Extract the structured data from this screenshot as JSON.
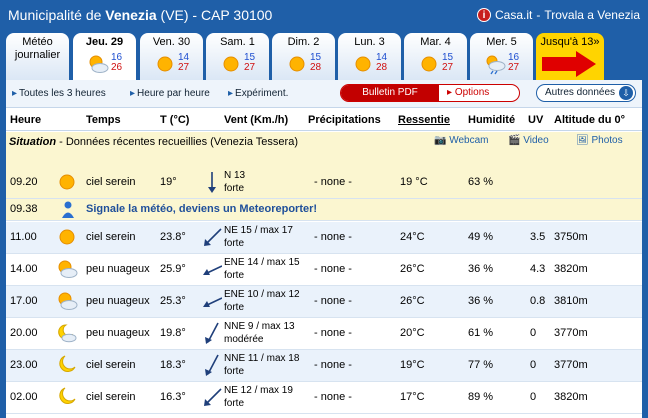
{
  "topbar": {
    "title_prefix": "Municipalité de",
    "city": "Venezia",
    "title_suffix": "(VE) - CAP 30100",
    "link_casa": "Casa.it",
    "link_sep": " - ",
    "link_trovala": "Trovala a Venezia"
  },
  "tabs": [
    {
      "day": "Météo journalier",
      "tmin": "",
      "tmax": ""
    },
    {
      "day": "Jeu. 29",
      "tmin": "16",
      "tmax": "26"
    },
    {
      "day": "Ven. 30",
      "tmin": "14",
      "tmax": "27"
    },
    {
      "day": "Sam. 1",
      "tmin": "15",
      "tmax": "27"
    },
    {
      "day": "Dim. 2",
      "tmin": "15",
      "tmax": "28"
    },
    {
      "day": "Lun. 3",
      "tmin": "14",
      "tmax": "28"
    },
    {
      "day": "Mar. 4",
      "tmin": "15",
      "tmax": "27"
    },
    {
      "day": "Mer. 5",
      "tmin": "16",
      "tmax": "27"
    },
    {
      "day": "Jusqu'à 13»",
      "tmin": "",
      "tmax": ""
    }
  ],
  "options": {
    "toutes": "Toutes les 3 heures",
    "heure": "Heure par heure",
    "experiment": "Expériment.",
    "pdf": "Bulletin PDF",
    "options": "Options",
    "autres": "Autres données"
  },
  "header": {
    "heure": "Heure",
    "temps": "Temps",
    "temp": "T (°C)",
    "vent": "Vent (Km./h)",
    "precip": "Précipitations",
    "ressentie": "Ressentie",
    "humidite": "Humidité",
    "uv": "UV",
    "altitude": "Altitude du 0°"
  },
  "situation": {
    "label": "Situation",
    "text": "- Données récentes recueillies (Venezia Tessera)",
    "webcam": "Webcam",
    "video": "Video",
    "photos": "Photos"
  },
  "meteo_msg": "Signale la météo, deviens un Meteoreporter!",
  "rows": [
    {
      "time": "09.20",
      "icon": "sun",
      "sky": "ciel serein",
      "temp": "19°",
      "wind": "N 13",
      "strength": "forte",
      "precip": "- none -",
      "feel": "19 °C",
      "hum": "63 %",
      "uv": "",
      "alt": ""
    },
    {
      "time": "09.38",
      "icon": "reporter",
      "sky": "",
      "temp": "",
      "wind": "",
      "strength": "",
      "precip": "",
      "feel": "",
      "hum": "",
      "uv": "",
      "alt": ""
    },
    {
      "time": "11.00",
      "icon": "sun",
      "sky": "ciel serein",
      "temp": "23.8°",
      "wind": "NE 15 / max 17",
      "strength": "forte",
      "precip": "- none -",
      "feel": "24°C",
      "hum": "49 %",
      "uv": "3.5",
      "alt": "3750m"
    },
    {
      "time": "14.00",
      "icon": "partly",
      "sky": "peu nuageux",
      "temp": "25.9°",
      "wind": "ENE 14 / max 15",
      "strength": "forte",
      "precip": "- none -",
      "feel": "26°C",
      "hum": "36 %",
      "uv": "4.3",
      "alt": "3820m"
    },
    {
      "time": "17.00",
      "icon": "partly",
      "sky": "peu nuageux",
      "temp": "25.3°",
      "wind": "ENE 10 / max 12",
      "strength": "forte",
      "precip": "- none -",
      "feel": "26°C",
      "hum": "36 %",
      "uv": "0.8",
      "alt": "3810m"
    },
    {
      "time": "20.00",
      "icon": "moon-cloud",
      "sky": "peu nuageux",
      "temp": "19.8°",
      "wind": "NNE 9 / max 13",
      "strength": "modérée",
      "precip": "- none -",
      "feel": "20°C",
      "hum": "61 %",
      "uv": "0",
      "alt": "3770m"
    },
    {
      "time": "23.00",
      "icon": "moon",
      "sky": "ciel serein",
      "temp": "18.3°",
      "wind": "NNE 11 / max 18",
      "strength": "forte",
      "precip": "- none -",
      "feel": "19°C",
      "hum": "77 %",
      "uv": "0",
      "alt": "3770m"
    },
    {
      "time": "02.00",
      "icon": "moon",
      "sky": "ciel serein",
      "temp": "16.3°",
      "wind": "NE 12 / max 19",
      "strength": "forte",
      "precip": "- none -",
      "feel": "17°C",
      "hum": "89 %",
      "uv": "0",
      "alt": "3820m"
    }
  ]
}
